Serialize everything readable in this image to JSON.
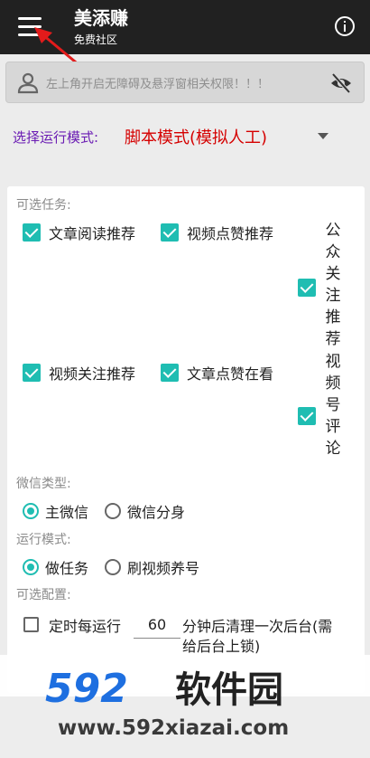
{
  "app": {
    "title": "美添赚",
    "subtitle": "免费社区"
  },
  "notice": {
    "text": "左上角开启无障碍及悬浮窗相关权限！！！"
  },
  "run_mode": {
    "label": "选择运行模式:",
    "selected": "脚本模式(模拟人工)"
  },
  "tasks": {
    "header": "可选任务:",
    "items": [
      {
        "label": "文章阅读推荐",
        "checked": true
      },
      {
        "label": "视频点赞推荐",
        "checked": true
      },
      {
        "label": "公众关注推荐",
        "checked": true
      },
      {
        "label": "视频关注推荐",
        "checked": true
      },
      {
        "label": "文章点赞在看",
        "checked": true
      },
      {
        "label": "视频号评论",
        "checked": true
      }
    ]
  },
  "wechat_type": {
    "header": "微信类型:",
    "options": [
      {
        "label": "主微信",
        "selected": true
      },
      {
        "label": "微信分身",
        "selected": false
      }
    ]
  },
  "operation_mode": {
    "header": "运行模式:",
    "options": [
      {
        "label": "做任务",
        "selected": true
      },
      {
        "label": "刷视频养号",
        "selected": false
      }
    ]
  },
  "config": {
    "header": "可选配置:",
    "timer_prefix": "定时每运行",
    "timer_value": "60",
    "timer_suffix": "分钟后清理一次后台(需",
    "timer_suffix2": "给后台上锁)"
  },
  "watermark": {
    "brand": "592软件园",
    "url": "www.592xiazai.com"
  },
  "colors": {
    "appbar": "#212121",
    "accent": "#1fbdb2",
    "mode_label": "#6a1bb3",
    "mode_value": "#d50000"
  }
}
